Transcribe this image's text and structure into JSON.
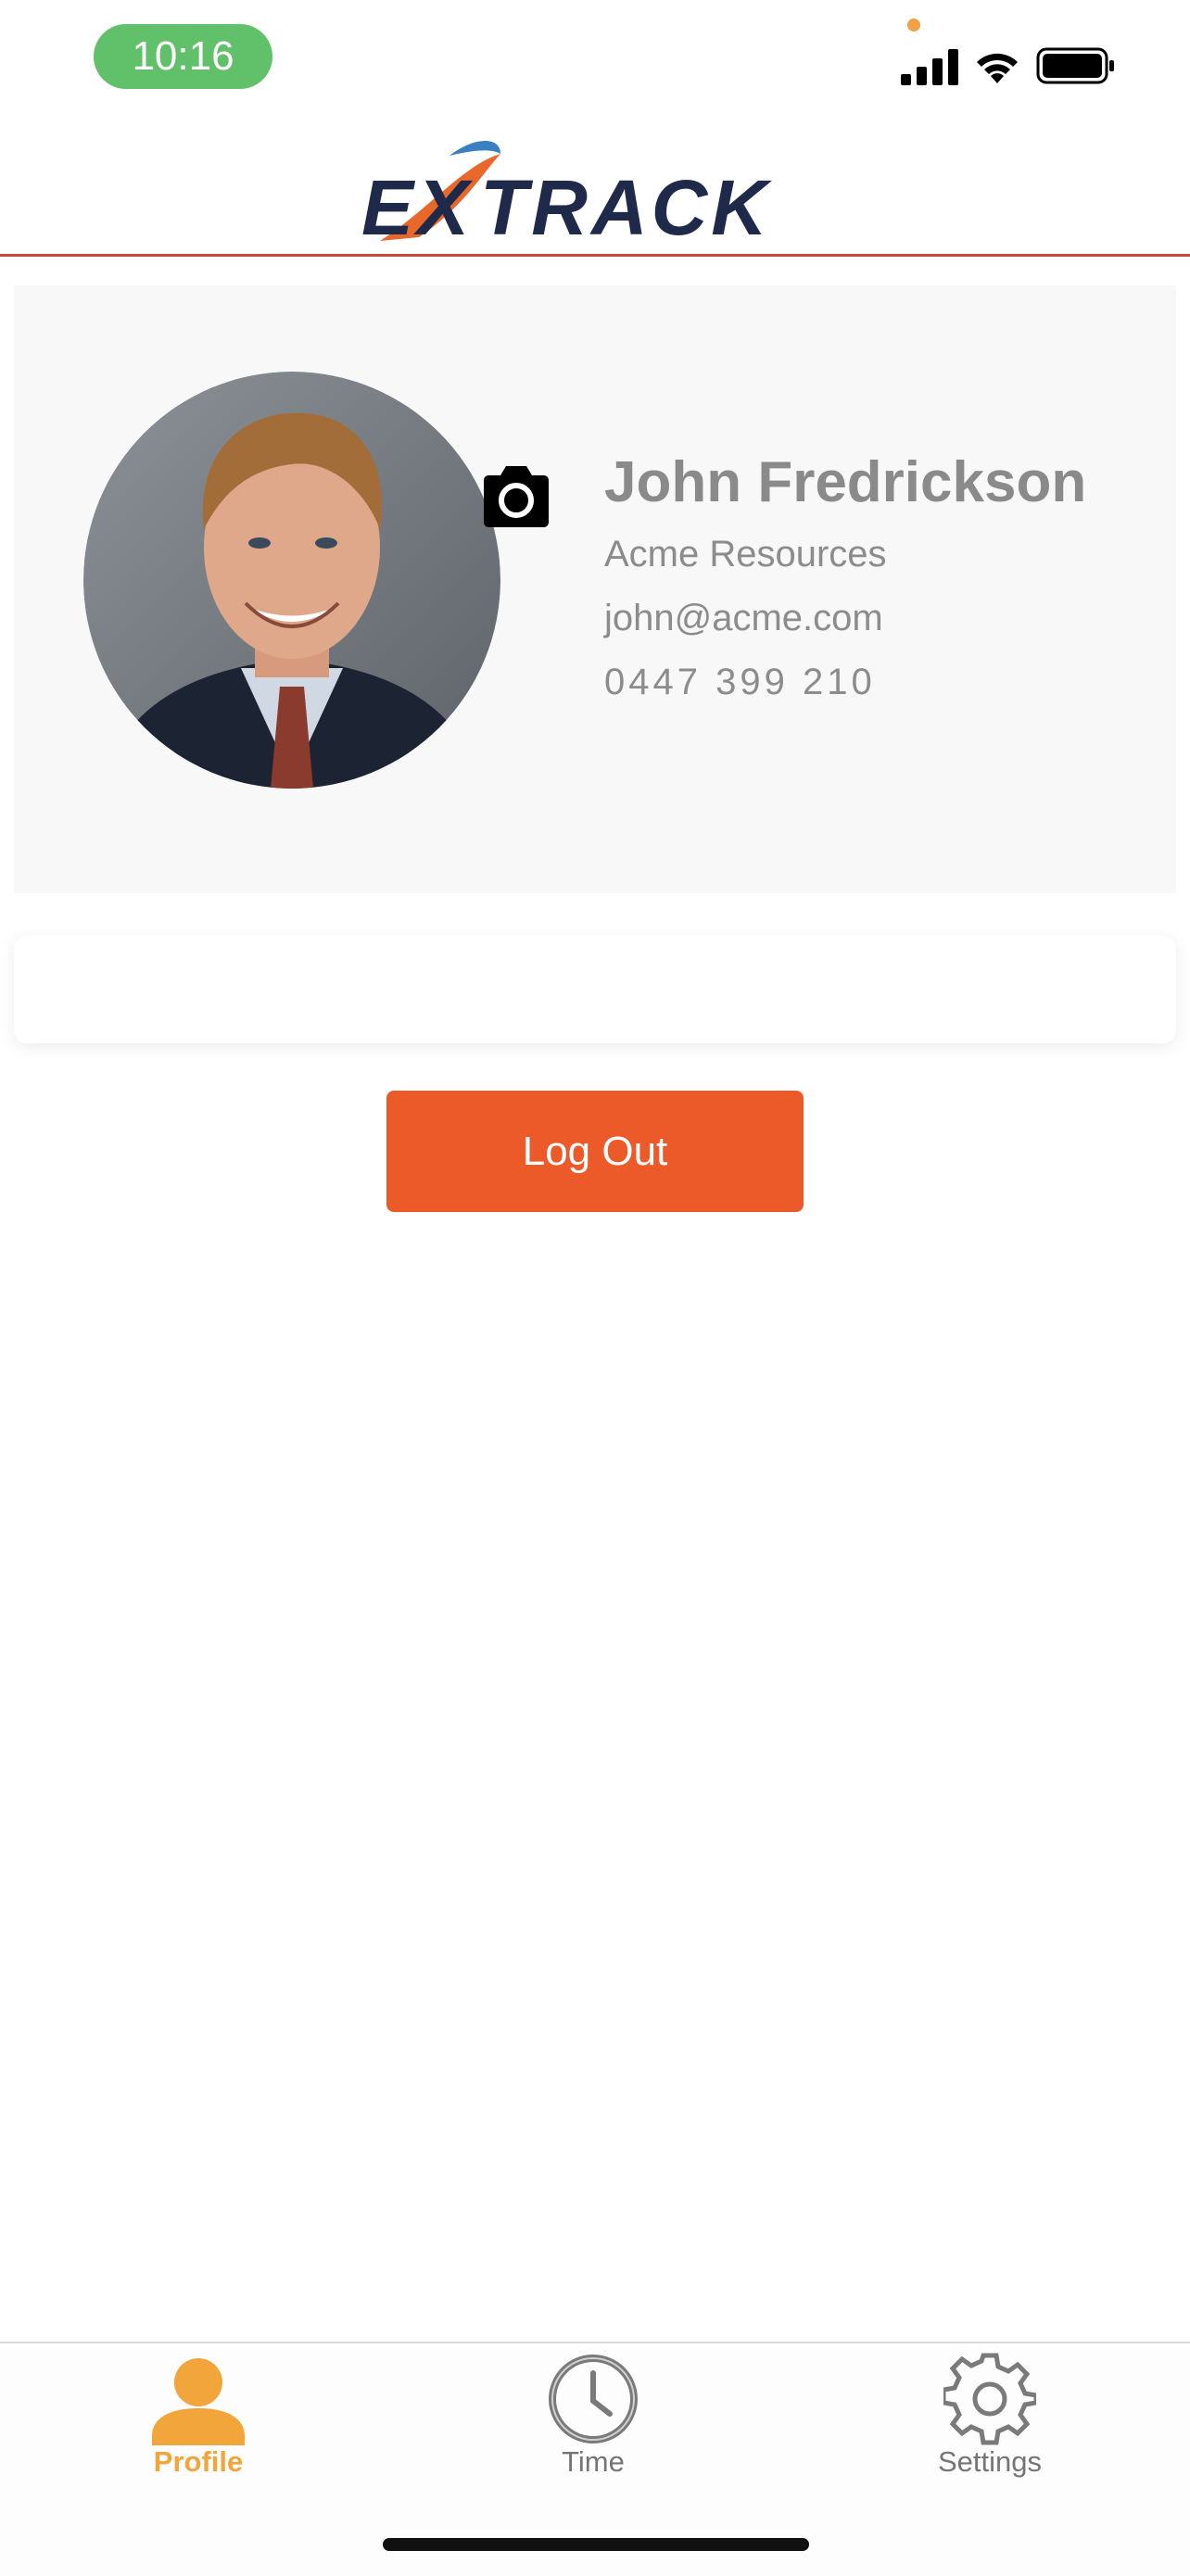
{
  "status_bar": {
    "time": "10:16",
    "icons": [
      "signal-icon",
      "wifi-icon",
      "battery-icon"
    ],
    "pill_color": "#61c16b"
  },
  "header": {
    "logo_text": "EXTRACK",
    "logo_colors": {
      "navy": "#1f2a4a",
      "orange": "#e8672a",
      "blue": "#3a7fc1"
    },
    "divider_color": "#c9473c"
  },
  "profile": {
    "name": "John Fredrickson",
    "company": "Acme Resources",
    "email": "john@acme.com",
    "phone": "0447 399 210",
    "camera_icon": "camera-icon"
  },
  "actions": {
    "logout_label": "Log Out",
    "logout_color": "#ec5a2a"
  },
  "tabs": [
    {
      "label": "Profile",
      "icon": "person-icon",
      "active": true,
      "color": "#f2a53a"
    },
    {
      "label": "Time",
      "icon": "clock-icon",
      "active": false,
      "color": "#757575"
    },
    {
      "label": "Settings",
      "icon": "gear-icon",
      "active": false,
      "color": "#757575"
    }
  ]
}
